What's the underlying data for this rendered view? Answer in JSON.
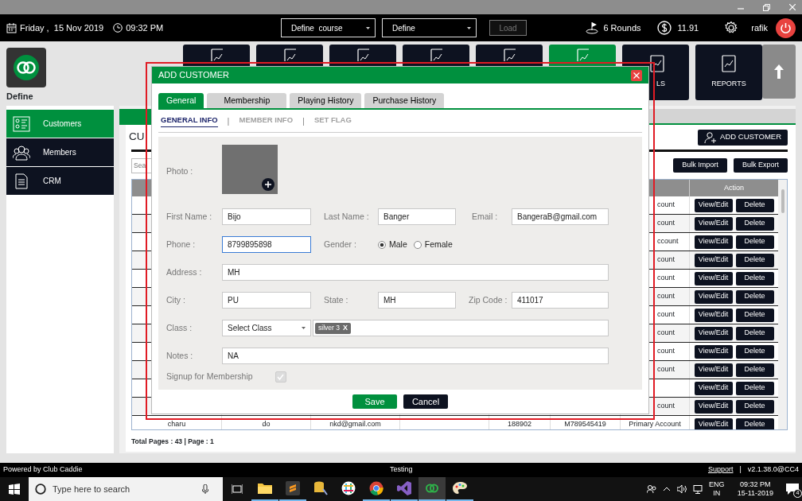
{
  "top_bar": {
    "date": "Friday ,  15 Nov 2019",
    "time": "09:32 PM",
    "course_select": "Define  course",
    "define_select": "Define",
    "load_button": {
      "label": "Load",
      "disabled": true
    },
    "rounds": "6 Rounds",
    "balance": "11.91",
    "user": "rafik"
  },
  "app": {
    "name": "Define"
  },
  "nav_tiles": [
    {
      "selected": false
    },
    {
      "selected": false
    },
    {
      "selected": false
    },
    {
      "selected": false
    },
    {
      "selected": false
    },
    {
      "selected": true
    },
    {
      "label": "LS",
      "selected": false
    },
    {
      "label": "REPORTS",
      "selected": false
    }
  ],
  "sidebar": {
    "items": [
      {
        "label": "Customers",
        "kind": "list",
        "selected": true
      },
      {
        "label": "Members",
        "kind": "people",
        "selected": false
      },
      {
        "label": "CRM",
        "kind": "document",
        "selected": false
      }
    ]
  },
  "content": {
    "title": "CU",
    "search": {
      "placeholder": "Sea"
    },
    "add_button": "ADD CUSTOMER",
    "bulk_buttons": [
      "Bulk Import",
      "Bulk Export"
    ],
    "table": {
      "action_header": "Action",
      "rows": [
        {
          "account": "count",
          "actions": [
            "View/Edit",
            "Delete"
          ]
        },
        {
          "account": "count",
          "actions": [
            "View/Edit",
            "Delete"
          ]
        },
        {
          "account": "ccount",
          "actions": [
            "View/Edit",
            "Delete"
          ]
        },
        {
          "account": "count",
          "actions": [
            "View/Edit",
            "Delete"
          ]
        },
        {
          "account": "count",
          "actions": [
            "View/Edit",
            "Delete"
          ]
        },
        {
          "account": "count",
          "actions": [
            "View/Edit",
            "Delete"
          ]
        },
        {
          "account": "count",
          "actions": [
            "View/Edit",
            "Delete"
          ]
        },
        {
          "account": "count",
          "actions": [
            "View/Edit",
            "Delete"
          ]
        },
        {
          "account": "count",
          "actions": [
            "View/Edit",
            "Delete"
          ]
        },
        {
          "account": "count",
          "actions": [
            "View/Edit",
            "Delete"
          ]
        },
        {
          "actions": [
            "View/Edit",
            "Delete"
          ]
        },
        {
          "account": "count",
          "actions": [
            "View/Edit",
            "Delete"
          ]
        },
        {
          "name": "charu",
          "column_2": "do",
          "email": "nkd@gmail.com",
          "column_5": "188902",
          "column_6": "M789545419",
          "account": "Primary Account",
          "actions": [
            "View/Edit",
            "Delete"
          ]
        }
      ]
    },
    "pages": "Total Pages : 43 | Page : 1"
  },
  "modal": {
    "title": "ADD CUSTOMER",
    "tabs": [
      {
        "label": "General",
        "selected": true
      },
      {
        "label": "Membership",
        "selected": false
      },
      {
        "label": "Playing History",
        "selected": false
      },
      {
        "label": "Purchase History",
        "selected": false
      }
    ],
    "subtab_separators": [
      "|",
      "|"
    ],
    "subtabs": [
      {
        "label": "GENERAL INFO",
        "selected": true
      },
      {
        "label": "MEMBER INFO",
        "selected": false
      },
      {
        "label": "SET FLAG",
        "selected": false
      }
    ],
    "photo_label": "Photo :",
    "fields": [
      {
        "kind": "text",
        "label": "First Name :",
        "value": "Bijo",
        "focused": false
      },
      {
        "kind": "text",
        "label": "Last Name :",
        "value": "Banger",
        "focused": false
      },
      {
        "kind": "text",
        "label": "Email :",
        "value": "BangeraB@gmail.com",
        "focused": false
      },
      {
        "kind": "text",
        "label": "Phone :",
        "value": "8799895898",
        "focused": true
      },
      {
        "kind": "radio",
        "label": "Gender :",
        "options": [
          {
            "label": "Male",
            "selected": true
          },
          {
            "label": "Female",
            "selected": false
          }
        ]
      },
      {
        "kind": "wide",
        "label": "Address :",
        "value": "MH",
        "focused": false
      },
      {
        "kind": "text",
        "label": "City :",
        "value": "PU",
        "focused": false
      },
      {
        "kind": "text",
        "label": "State :",
        "value": "MH",
        "focused": false
      },
      {
        "kind": "text",
        "label": "Zip Code :",
        "value": "411017",
        "focused": false
      },
      {
        "kind": "select_tags",
        "label": "Class :",
        "value": "Select Class",
        "tags": [
          {
            "label": "silver 3",
            "remove": "X"
          }
        ]
      },
      {
        "kind": "wide",
        "label": "Notes :",
        "value": "NA",
        "focused": false
      },
      {
        "kind": "checkbox",
        "label": "Signup for Membership",
        "checked": true,
        "disabled": true
      }
    ],
    "buttons": [
      {
        "label": "Save",
        "kind": "primary"
      },
      {
        "label": "Cancel",
        "kind": "secondary"
      }
    ]
  },
  "status_bar": {
    "powered": "Powered by Club Caddie",
    "environment": "Testing",
    "support": "Support",
    "separator": "|",
    "version": "v2.1.38.0@CC4"
  },
  "taskbar": {
    "search": {
      "placeholder": "Type here to search"
    },
    "apps": [
      {
        "kind": "folder",
        "running": true,
        "selected": false
      },
      {
        "kind": "editor",
        "running": true,
        "selected": false
      },
      {
        "kind": "database",
        "running": false,
        "selected": false
      },
      {
        "kind": "chat",
        "running": false,
        "selected": false
      },
      {
        "kind": "browser",
        "running": true,
        "selected": false
      },
      {
        "kind": "studio",
        "running": true,
        "selected": false
      },
      {
        "kind": "rings",
        "running": true,
        "selected": true
      },
      {
        "kind": "paint",
        "running": true,
        "selected": false
      }
    ],
    "language": "ENG",
    "region": "IN",
    "time": "09:32 PM",
    "date": "15-11-2019",
    "notifications": "4"
  }
}
